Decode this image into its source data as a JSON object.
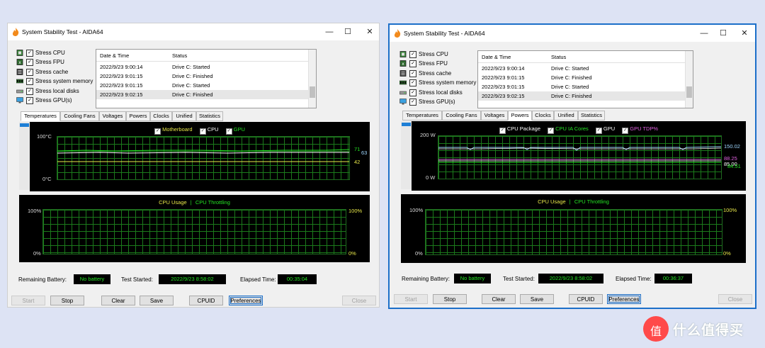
{
  "windows": [
    {
      "title": "System Stability Test - AIDA64",
      "controls": {
        "minimize": "—",
        "maximize": "☐",
        "close": "✕"
      },
      "checks": [
        "Stress CPU",
        "Stress FPU",
        "Stress cache",
        "Stress system memory",
        "Stress local disks",
        "Stress GPU(s)"
      ],
      "log": {
        "headers": [
          "Date & Time",
          "Status"
        ],
        "rows": [
          [
            "2022/9/23 9:00:14",
            "Drive C: Started"
          ],
          [
            "2022/9/23 9:01:15",
            "Drive C: Finished"
          ],
          [
            "2022/9/23 9:01:15",
            "Drive C: Started"
          ],
          [
            "2022/9/23 9:02:15",
            "Drive C: Finished"
          ]
        ]
      },
      "tabs": [
        "Temperatures",
        "Cooling Fans",
        "Voltages",
        "Powers",
        "Clocks",
        "Unified",
        "Statistics"
      ],
      "active_tab": "Temperatures",
      "graph1": {
        "legend": [
          {
            "label": "Motherboard",
            "color": "#e8e84a"
          },
          {
            "label": "CPU",
            "color": "#ffffff"
          },
          {
            "label": "GPU",
            "color": "#24e424"
          }
        ],
        "y_top": "100°C",
        "y_bottom": "0°C",
        "values": [
          {
            "text": "71",
            "color": "#24e424"
          },
          {
            "text": "63",
            "color": "#9fd7ff"
          },
          {
            "text": "42",
            "color": "#e8e84a"
          }
        ]
      },
      "graph2": {
        "legend": [
          {
            "label": "CPU Usage",
            "color": "#e8e84a"
          },
          {
            "label": "CPU Throttling",
            "color": "#24e424"
          }
        ],
        "sep": "|",
        "y_top_left": "100%",
        "y_bottom_left": "0%",
        "y_top_right": "100%",
        "y_bottom_right": "0%"
      },
      "status": {
        "battery_label": "Remaining Battery:",
        "battery_value": "No battery",
        "started_label": "Test Started:",
        "started_value": "2022/9/23 8:58:02",
        "elapsed_label": "Elapsed Time:",
        "elapsed_value": "00:35:04"
      },
      "buttons": [
        "Start",
        "Stop",
        "Clear",
        "Save",
        "CPUID",
        "Preferences",
        "Close"
      ]
    },
    {
      "title": "System Stability Test - AIDA64",
      "controls": {
        "minimize": "—",
        "maximize": "☐",
        "close": "✕"
      },
      "checks": [
        "Stress CPU",
        "Stress FPU",
        "Stress cache",
        "Stress system memory",
        "Stress local disks",
        "Stress GPU(s)"
      ],
      "log": {
        "headers": [
          "Date & Time",
          "Status"
        ],
        "rows": [
          [
            "2022/9/23 9:00:14",
            "Drive C: Started"
          ],
          [
            "2022/9/23 9:01:15",
            "Drive C: Finished"
          ],
          [
            "2022/9/23 9:01:15",
            "Drive C: Started"
          ],
          [
            "2022/9/23 9:02:15",
            "Drive C: Finished"
          ]
        ]
      },
      "tabs": [
        "Temperatures",
        "Cooling Fans",
        "Voltages",
        "Powers",
        "Clocks",
        "Unified",
        "Statistics"
      ],
      "active_tab": "Powers",
      "graph1": {
        "legend": [
          {
            "label": "CPU Package",
            "color": "#ffffff"
          },
          {
            "label": "CPU IA Cores",
            "color": "#24e424"
          },
          {
            "label": "GPU",
            "color": "#ffffff"
          },
          {
            "label": "GPU TDP%",
            "color": "#e060e0"
          }
        ],
        "y_top": "200 W",
        "y_bottom": "0 W",
        "values": [
          {
            "text": "150.02",
            "color": "#9fd7ff"
          },
          {
            "text": "88.25",
            "color": "#e060e0"
          },
          {
            "text": "85.00",
            "color": "#ffffff"
          },
          {
            "text": "84.51",
            "color": "#24e424"
          }
        ]
      },
      "graph2": {
        "legend": [
          {
            "label": "CPU Usage",
            "color": "#e8e84a"
          },
          {
            "label": "CPU Throttling",
            "color": "#24e424"
          }
        ],
        "sep": "|",
        "y_top_left": "100%",
        "y_bottom_left": "0%",
        "y_top_right": "100%",
        "y_bottom_right": "0%"
      },
      "status": {
        "battery_label": "Remaining Battery:",
        "battery_value": "No battery",
        "started_label": "Test Started:",
        "started_value": "2022/9/23 8:58:02",
        "elapsed_label": "Elapsed Time:",
        "elapsed_value": "00:36:37"
      },
      "buttons": [
        "Start",
        "Stop",
        "Clear",
        "Save",
        "CPUID",
        "Preferences",
        "Close"
      ]
    }
  ],
  "watermark": {
    "text": "什么值得买",
    "logo_glyph": "值"
  }
}
